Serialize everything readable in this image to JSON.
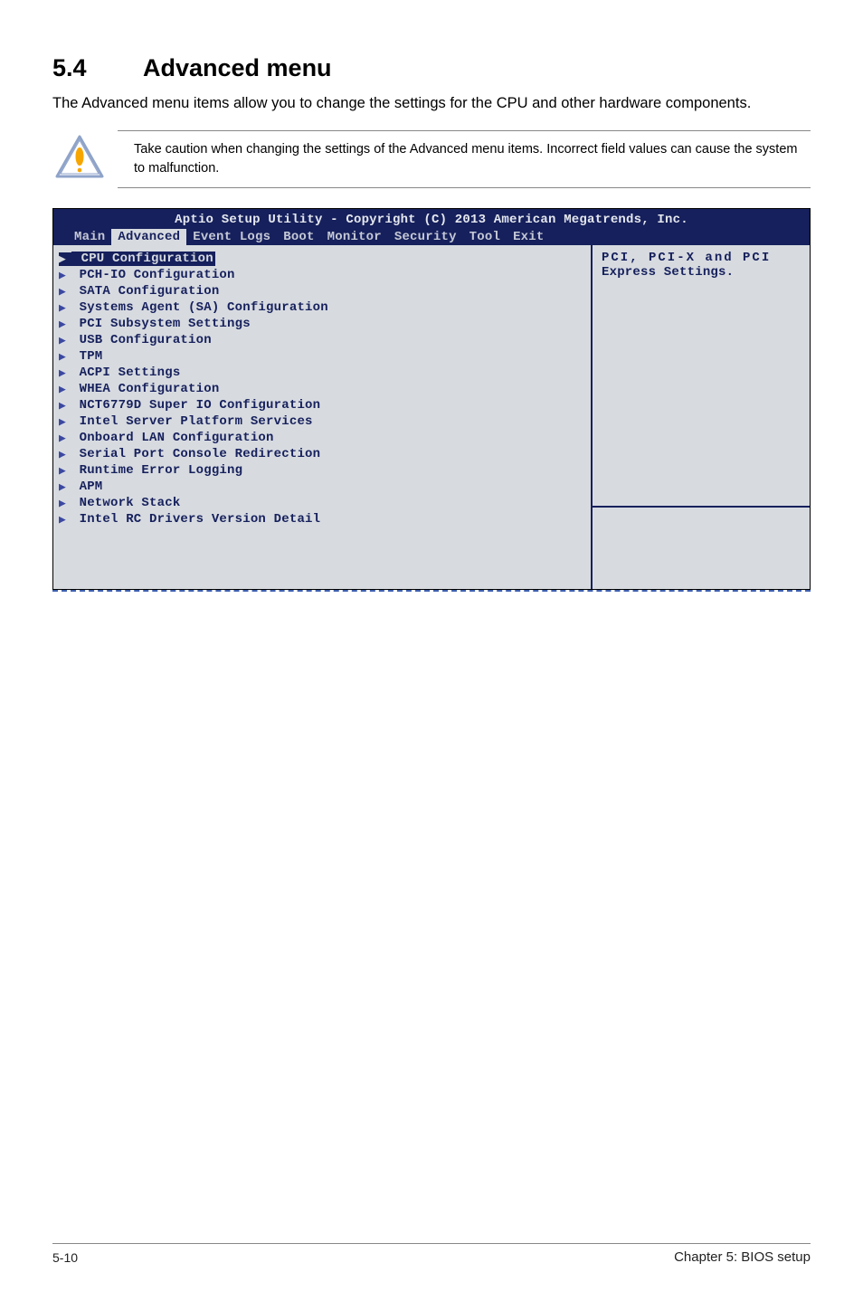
{
  "heading": {
    "number": "5.4",
    "title": "Advanced menu"
  },
  "intro": "The Advanced menu items allow you to change the settings for the CPU and other hardware components.",
  "caution": "Take caution when changing the settings of the Advanced menu items. Incorrect field values can cause the system to malfunction.",
  "bios": {
    "title": "Aptio Setup Utility - Copyright (C) 2013 American Megatrends, Inc.",
    "tabs": [
      "Main",
      "Advanced",
      "Event Logs",
      "Boot",
      "Monitor",
      "Security",
      "Tool",
      "Exit"
    ],
    "active_tab_index": 1,
    "items": [
      "CPU Configuration",
      "PCH-IO Configuration",
      "SATA Configuration",
      "Systems Agent (SA) Configuration",
      "PCI Subsystem Settings",
      "USB Configuration",
      "TPM",
      "ACPI Settings",
      "WHEA Configuration",
      "NCT6779D Super IO Configuration",
      "Intel Server Platform Services",
      "Onboard LAN Configuration",
      "Serial Port Console Redirection",
      "Runtime Error Logging",
      "APM",
      "Network Stack",
      "Intel RC Drivers Version Detail"
    ],
    "selected_index": 0,
    "help_line1": "PCI, PCI-X and PCI",
    "help_line2": "Express Settings."
  },
  "footer": {
    "page": "5-10",
    "chapter": "Chapter 5: BIOS setup"
  }
}
